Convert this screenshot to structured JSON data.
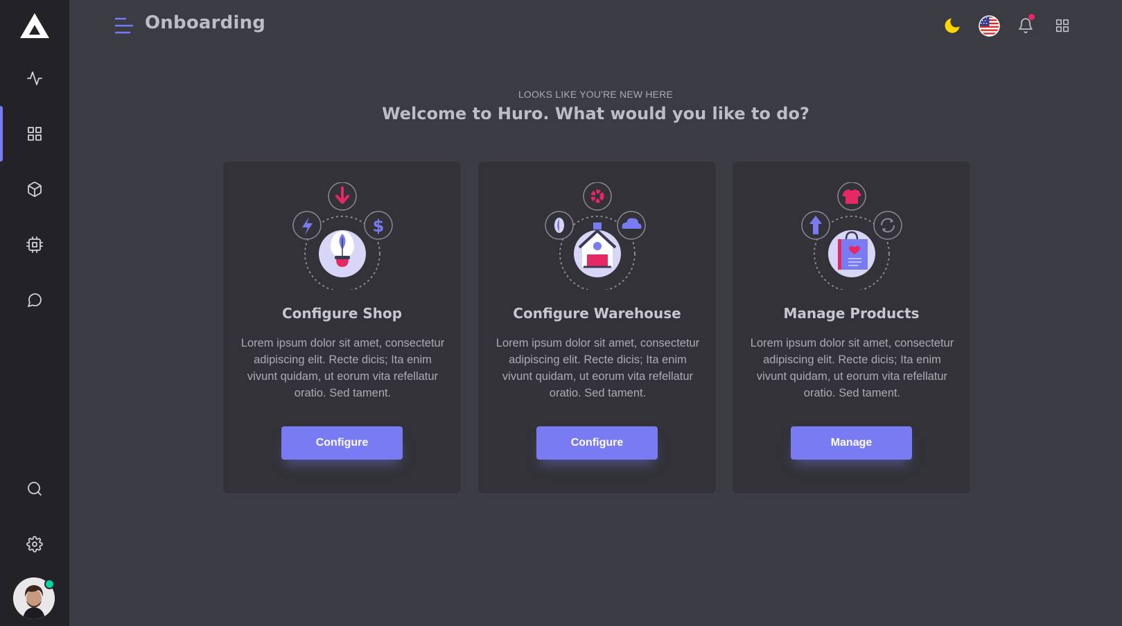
{
  "app": {
    "page_title": "Onboarding"
  },
  "sidebar": {
    "items": [
      {
        "icon": "activity-icon"
      },
      {
        "icon": "grid-icon",
        "active": true
      },
      {
        "icon": "box-icon"
      },
      {
        "icon": "cpu-icon"
      },
      {
        "icon": "message-icon"
      }
    ],
    "bottom": [
      {
        "icon": "search-icon"
      },
      {
        "icon": "settings-icon"
      }
    ],
    "user": {
      "status": "online"
    }
  },
  "header": {
    "icons": [
      "moon-icon",
      "us-flag-icon",
      "bell-icon",
      "apps-grid-icon"
    ]
  },
  "hero": {
    "subtitle": "LOOKS LIKE YOU'RE NEW HERE",
    "title": "Welcome to Huro. What would you like to do?"
  },
  "cards": [
    {
      "title": "Configure Shop",
      "text": "Lorem ipsum dolor sit amet, consectetur adipiscing elit. Recte dicis; Ita enim vivunt quidam, ut eorum vita refellatur oratio. Sed tament.",
      "button": "Configure"
    },
    {
      "title": "Configure Warehouse",
      "text": "Lorem ipsum dolor sit amet, consectetur adipiscing elit. Recte dicis; Ita enim vivunt quidam, ut eorum vita refellatur oratio. Sed tament.",
      "button": "Configure"
    },
    {
      "title": "Manage Products",
      "text": "Lorem ipsum dolor sit amet, consectetur adipiscing elit. Recte dicis; Ita enim vivunt quidam, ut eorum vita refellatur oratio. Sed tament.",
      "button": "Manage"
    }
  ],
  "colors": {
    "accent": "#797bf2",
    "pink": "#e62965",
    "sidebar_bg": "#232327",
    "page_bg": "#3b3b43",
    "card_bg": "#323238",
    "online": "#06d6a0"
  }
}
